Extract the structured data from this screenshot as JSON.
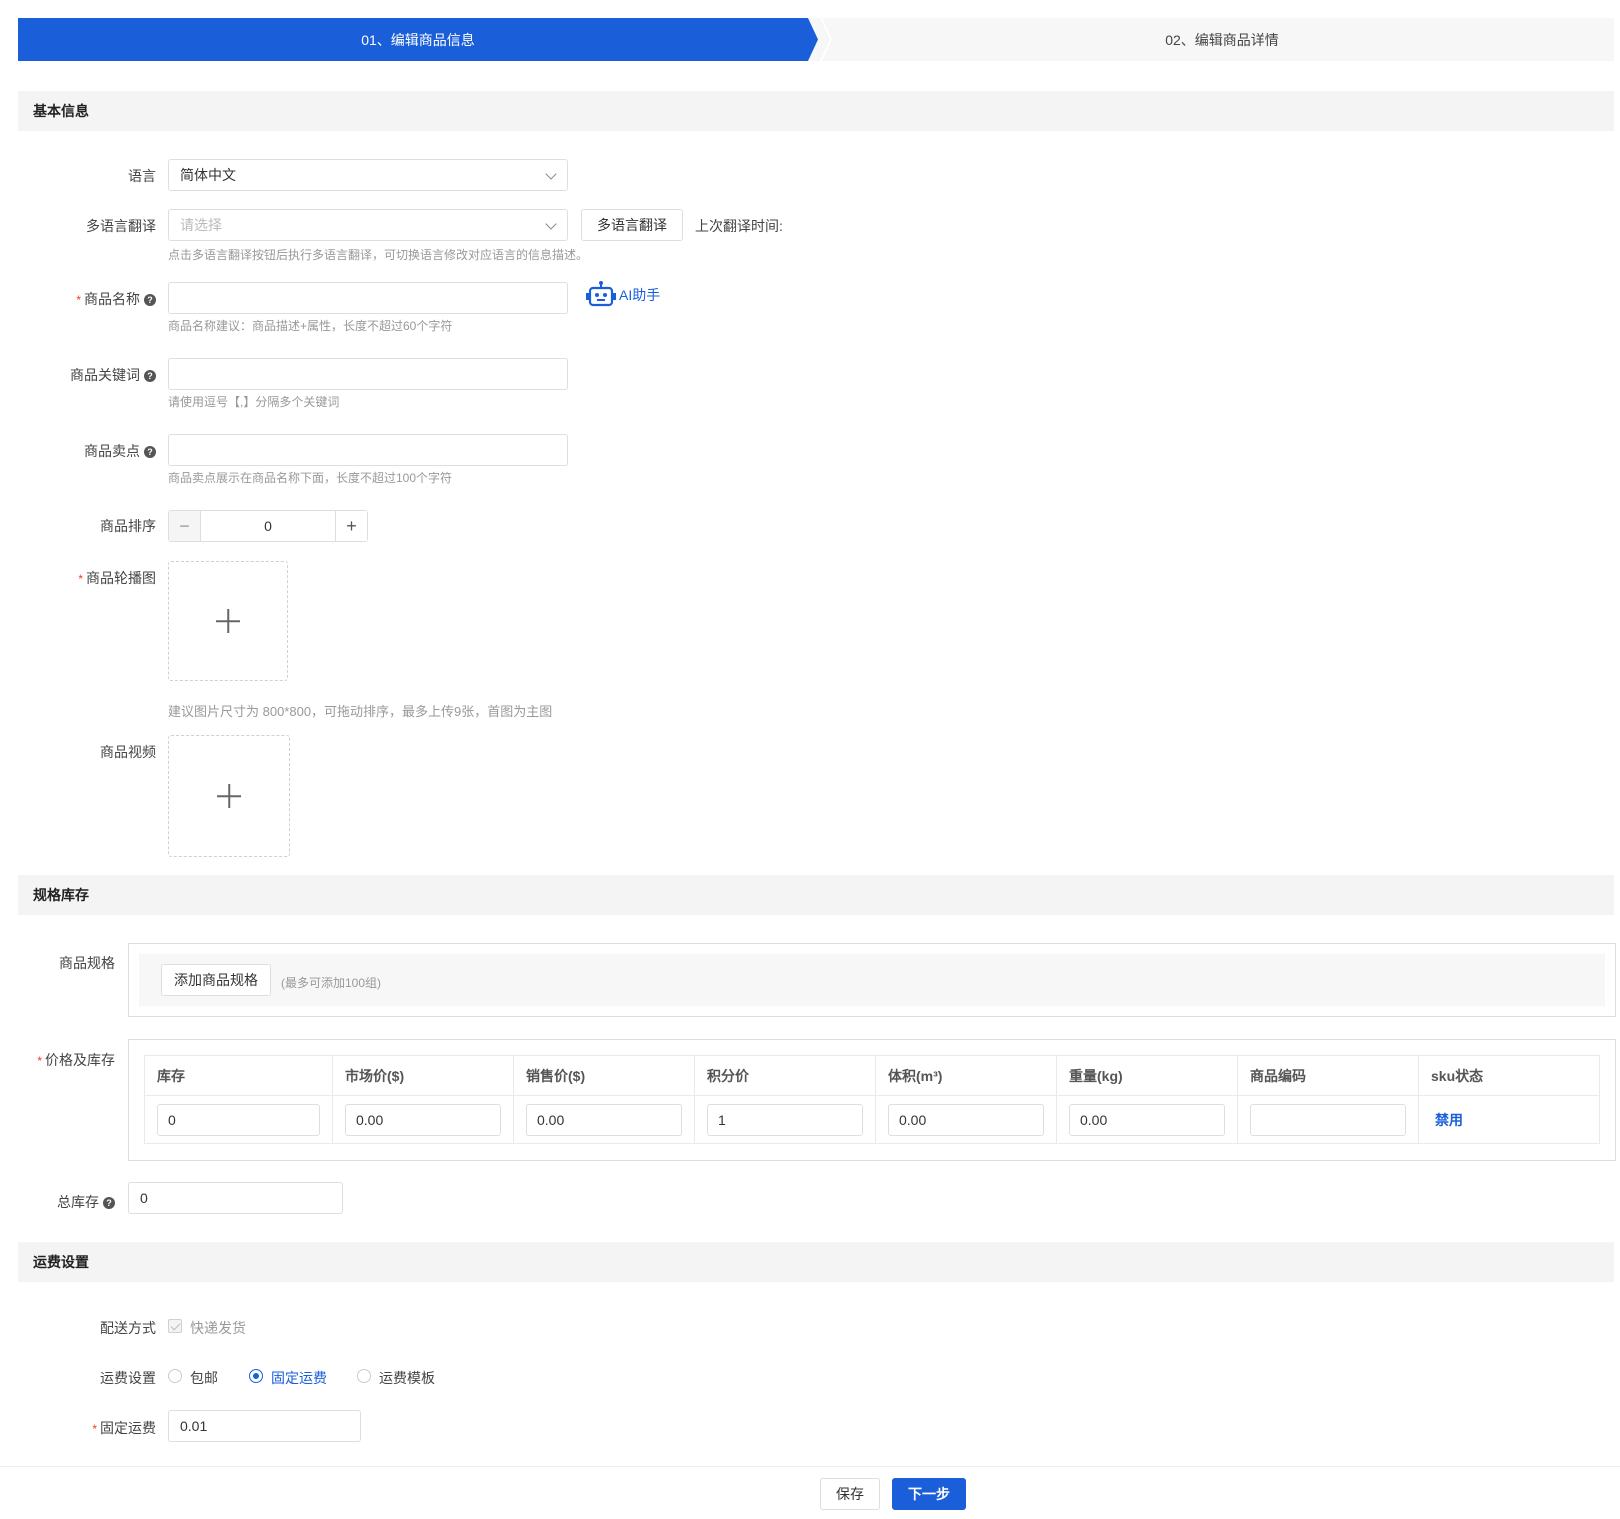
{
  "steps": {
    "step1": "01、编辑商品信息",
    "step2": "02、编辑商品详情"
  },
  "sections": {
    "basic": "基本信息",
    "spec": "规格库存",
    "shipping": "运费设置"
  },
  "basic": {
    "language": {
      "label": "语言",
      "value": "简体中文"
    },
    "multilang": {
      "label": "多语言翻译",
      "placeholder": "请选择",
      "button": "多语言翻译",
      "last_time_label": "上次翻译时间:",
      "hint": "点击多语言翻译按钮后执行多语言翻译，可切换语言修改对应语言的信息描述。"
    },
    "name": {
      "label": "商品名称",
      "value": "",
      "ai_label": "AI助手",
      "hint": "商品名称建议：商品描述+属性，长度不超过60个字符"
    },
    "keywords": {
      "label": "商品关键词",
      "value": "",
      "hint": "请使用逗号【,】分隔多个关键词"
    },
    "selling": {
      "label": "商品卖点",
      "value": "",
      "hint": "商品卖点展示在商品名称下面，长度不超过100个字符"
    },
    "sort": {
      "label": "商品排序",
      "value": "0",
      "minus": "−",
      "plus": "+"
    },
    "carousel": {
      "label": "商品轮播图",
      "hint": "建议图片尺寸为 800*800，可拖动排序，最多上传9张，首图为主图"
    },
    "video": {
      "label": "商品视频"
    }
  },
  "spec": {
    "spec_label": "商品规格",
    "add_button": "添加商品规格",
    "add_hint": "(最多可添加100组)",
    "price_label": "价格及库存",
    "columns": [
      "库存",
      "市场价($)",
      "销售价($)",
      "积分价",
      "体积(m³)",
      "重量(kg)",
      "商品编码",
      "sku状态"
    ],
    "row": [
      "0",
      "0.00",
      "0.00",
      "1",
      "0.00",
      "0.00",
      "",
      "禁用"
    ],
    "total_label": "总库存",
    "total_value": "0"
  },
  "shipping": {
    "method_label": "配送方式",
    "method_option": "快递发货",
    "fee_label": "运费设置",
    "fee_options": [
      "包邮",
      "固定运费",
      "运费模板"
    ],
    "fee_selected": "固定运费",
    "fixed_label": "固定运费",
    "fixed_value": "0.01"
  },
  "footer": {
    "save": "保存",
    "next": "下一步"
  },
  "colors": {
    "primary": "#1a5fd9",
    "required": "#ed4014"
  }
}
